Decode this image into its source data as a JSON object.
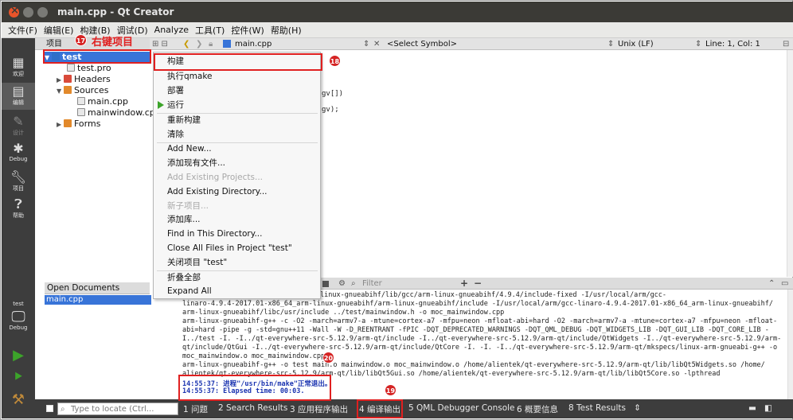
{
  "window": {
    "title": "main.cpp - Qt Creator"
  },
  "menubar": [
    "文件(F)",
    "编辑(E)",
    "构建(B)",
    "调试(D)",
    "Analyze",
    "工具(T)",
    "控件(W)",
    "帮助(H)"
  ],
  "modes": [
    {
      "label": "欢迎",
      "icon": "grid-icon"
    },
    {
      "label": "编辑",
      "icon": "edit-icon"
    },
    {
      "label": "设计",
      "icon": "design-icon"
    },
    {
      "label": "Debug",
      "icon": "bug-icon"
    },
    {
      "label": "项目",
      "icon": "wrench-icon"
    },
    {
      "label": "帮助",
      "icon": "help-icon"
    }
  ],
  "bottom_modes": {
    "target": "test",
    "debug": "Debug"
  },
  "projects": {
    "header": "项目",
    "tree": [
      {
        "label": "test",
        "level": 0,
        "selected": true,
        "expanded": true
      },
      {
        "label": "test.pro",
        "level": 1
      },
      {
        "label": "Headers",
        "level": 1
      },
      {
        "label": "Sources",
        "level": 1,
        "expanded": true
      },
      {
        "label": "main.cpp",
        "level": 2
      },
      {
        "label": "mainwindow.cpp",
        "level": 2
      },
      {
        "label": "Forms",
        "level": 1
      }
    ]
  },
  "editor_toolbar": {
    "file": "main.cpp",
    "symbol": "<Select Symbol>",
    "line_ending": "Unix (LF)",
    "position": "Line: 1, Col: 1"
  },
  "code_fragments": [
    "gv[])",
    "gv);"
  ],
  "context_menu": {
    "items": [
      {
        "label": "构建",
        "enabled": true
      },
      {
        "label": "执行qmake",
        "enabled": true
      },
      {
        "label": "部署",
        "enabled": true
      },
      {
        "label": "运行",
        "enabled": true
      },
      {
        "label": "重新构建",
        "enabled": true
      },
      {
        "label": "清除",
        "enabled": true
      },
      {
        "label": "Add New...",
        "enabled": true
      },
      {
        "label": "添加现有文件...",
        "enabled": true
      },
      {
        "label": "Add Existing Projects...",
        "enabled": false
      },
      {
        "label": "Add Existing Directory...",
        "enabled": true
      },
      {
        "label": "新子项目...",
        "enabled": false
      },
      {
        "label": "添加库...",
        "enabled": true
      },
      {
        "label": "Find in This Directory...",
        "enabled": true
      },
      {
        "label": "Close All Files in Project \"test\"",
        "enabled": true
      },
      {
        "label": "关闭项目 \"test\"",
        "enabled": true
      },
      {
        "label": "折叠全部",
        "enabled": true
      },
      {
        "label": "Expand All",
        "enabled": true
      }
    ]
  },
  "open_documents": {
    "header": "Open Documents",
    "items": [
      "main.cpp"
    ]
  },
  "output_pane": {
    "filter_placeholder": "Filter",
    "lines": [
      "-4.9.4-2017.01-x86_64_arm-linux-gnueabihf/lib/gcc/arm-linux-gnueabihf/4.9.4/include-fixed -I/usr/local/arm/gcc-",
      "linaro-4.9.4-2017.01-x86_64_arm-linux-gnueabihf/arm-linux-gnueabihf/include -I/usr/local/arm/gcc-linaro-4.9.4-2017.01-x86_64_arm-linux-gnueabihf/",
      "arm-linux-gnueabihf/libc/usr/include ../test/mainwindow.h -o moc_mainwindow.cpp",
      "arm-linux-gnueabihf-g++ -c -O2 -march=armv7-a -mtune=cortex-a7 -mfpu=neon -mfloat-abi=hard -O2 -march=armv7-a -mtune=cortex-a7 -mfpu=neon -mfloat-",
      "abi=hard -pipe -g -std=gnu++11 -Wall -W -D_REENTRANT -fPIC -DQT_DEPRECATED_WARNINGS -DQT_QML_DEBUG -DQT_WIDGETS_LIB -DQT_GUI_LIB -DQT_CORE_LIB -",
      "I../test -I. -I../qt-everywhere-src-5.12.9/arm-qt/include -I../qt-everywhere-src-5.12.9/arm-qt/include/QtWidgets -I../qt-everywhere-src-5.12.9/arm-",
      "qt/include/QtGui -I../qt-everywhere-src-5.12.9/arm-qt/include/QtCore -I. -I. -I../qt-everywhere-src-5.12.9/arm-qt/mkspecs/linux-arm-gnueabi-g++ -o",
      "moc_mainwindow.o moc_mainwindow.cpp",
      "arm-linux-gnueabihf-g++ -o test main.o mainwindow.o moc_mainwindow.o   /home/alientek/qt-everywhere-src-5.12.9/arm-qt/lib/libQt5Widgets.so /home/",
      "alientek/qt-everywhere-src-5.12.9/arm-qt/lib/libQt5Gui.so /home/alientek/qt-everywhere-src-5.12.9/arm-qt/lib/libQt5Core.so -lpthread"
    ],
    "status_lines": [
      "14:55:37: 进程\"/usr/bin/make\"正常退出。",
      "14:55:37: Elapsed time: 00:03."
    ]
  },
  "statusbar": {
    "locate_placeholder": "Type to locate (Ctrl...",
    "tabs": [
      "1 问题",
      "2 Search Results",
      "3 应用程序输出",
      "4 编译输出",
      "5 QML Debugger Console",
      "6 概要信息",
      "8 Test Results"
    ]
  },
  "annotations": {
    "step17": {
      "num": "17",
      "text": "右键项目"
    },
    "step18": {
      "num": "18"
    },
    "step19": {
      "num": "19"
    },
    "step20": {
      "num": "20"
    }
  },
  "colors": {
    "selection": "#3874d8",
    "annotation_red": "#e02020",
    "status_blue": "#1a33b0"
  }
}
